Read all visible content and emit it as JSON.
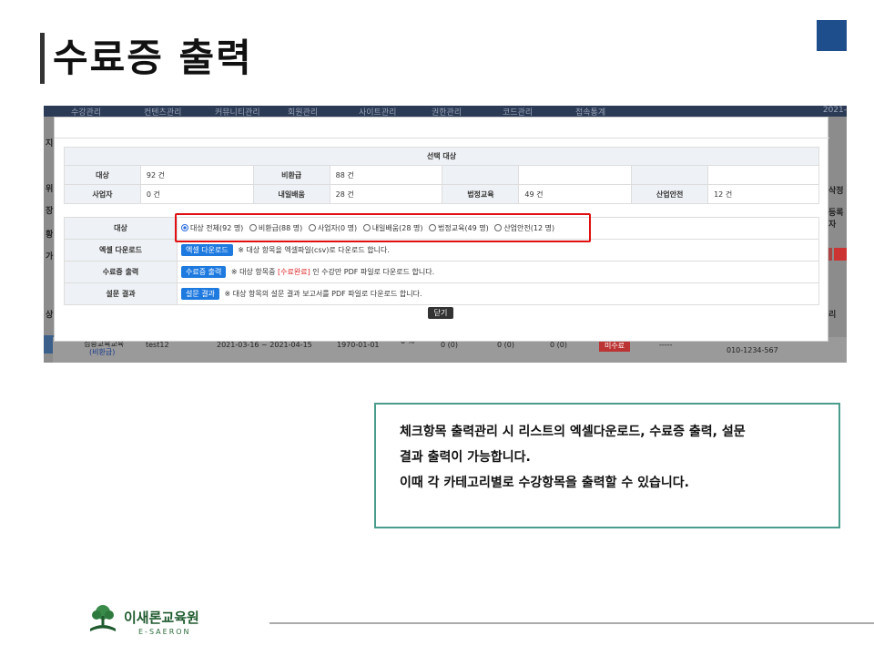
{
  "slide": {
    "title": "수료증 출력"
  },
  "background": {
    "nav_items": [
      "수강관리",
      "컨텐츠관리",
      "커뮤니티관리",
      "회원관리",
      "사이트관리",
      "권한관리",
      "코드관리",
      "접속통계"
    ],
    "nav_version": "2021-",
    "left_letters": [
      "지",
      "위",
      "장",
      "황",
      "가",
      "상"
    ],
    "right_letters": [
      "삭정",
      "등록자",
      "리"
    ],
    "row": {
      "course": "집중교육교육",
      "course_sub": "(비환급)",
      "user": "test12",
      "period": "2021-03-16 ~ 2021-04-15",
      "birth": "1970-01-01",
      "v1": "0 %",
      "c1": "0 (0)",
      "c2": "0 (0)",
      "c3": "0 (0)",
      "status": "미수료",
      "dash": "-----",
      "phone": "010-1234-567"
    }
  },
  "modal": {
    "caption": "선택 대상",
    "summary_rows": [
      [
        {
          "h": "대상",
          "v": "92 건"
        },
        {
          "h": "비환급",
          "v": "88 건"
        },
        {
          "h": "",
          "v": ""
        },
        {
          "h": "",
          "v": ""
        }
      ],
      [
        {
          "h": "사업자",
          "v": "0 건"
        },
        {
          "h": "내일배움",
          "v": "28 건"
        },
        {
          "h": "법정교육",
          "v": "49 건"
        },
        {
          "h": "산업안전",
          "v": "12 건"
        }
      ]
    ],
    "target_label": "대상",
    "radios": [
      "대상 전체(92 명)",
      "비환급(88 명)",
      "사업자(0 명)",
      "내일배움(28 명)",
      "법정교육(49 명)",
      "산업안전(12 명)"
    ],
    "excel_label": "엑셀 다운로드",
    "excel_button": "엑셀 다운로드",
    "excel_desc": "※ 대상 항목을 엑셀파일(csv)로 다운로드 합니다.",
    "cert_label": "수료증 출력",
    "cert_button": "수료증 출력",
    "cert_desc_pre": "※ 대상 항목중",
    "cert_desc_red": "[수료완료]",
    "cert_desc_post": "인 수강만 PDF 파일로 다운로드 합니다.",
    "survey_label": "설문 결과",
    "survey_button": "설문 결과",
    "survey_desc": "※ 대상 항목의 설문 결과 보고서를 PDF 파일로 다운로드 합니다.",
    "close_button": "닫기"
  },
  "callout": {
    "line1": "체크항목 출력관리 시 리스트의 엑셀다운로드, 수료증 출력, 설문",
    "line2": "결과 출력이 가능합니다.",
    "line3": "이때 각 카테고리별로 수강항목을 출력할 수 있습니다."
  },
  "footer": {
    "logo_name": "이새론교육원",
    "logo_sub": "E-SAERON"
  },
  "colors": {
    "accent_square": "#1f4e8c",
    "callout_border": "#4a9c8c",
    "highlight": "#e01010",
    "button_blue": "#1f7ae0",
    "logo_green": "#1f5a2e"
  }
}
